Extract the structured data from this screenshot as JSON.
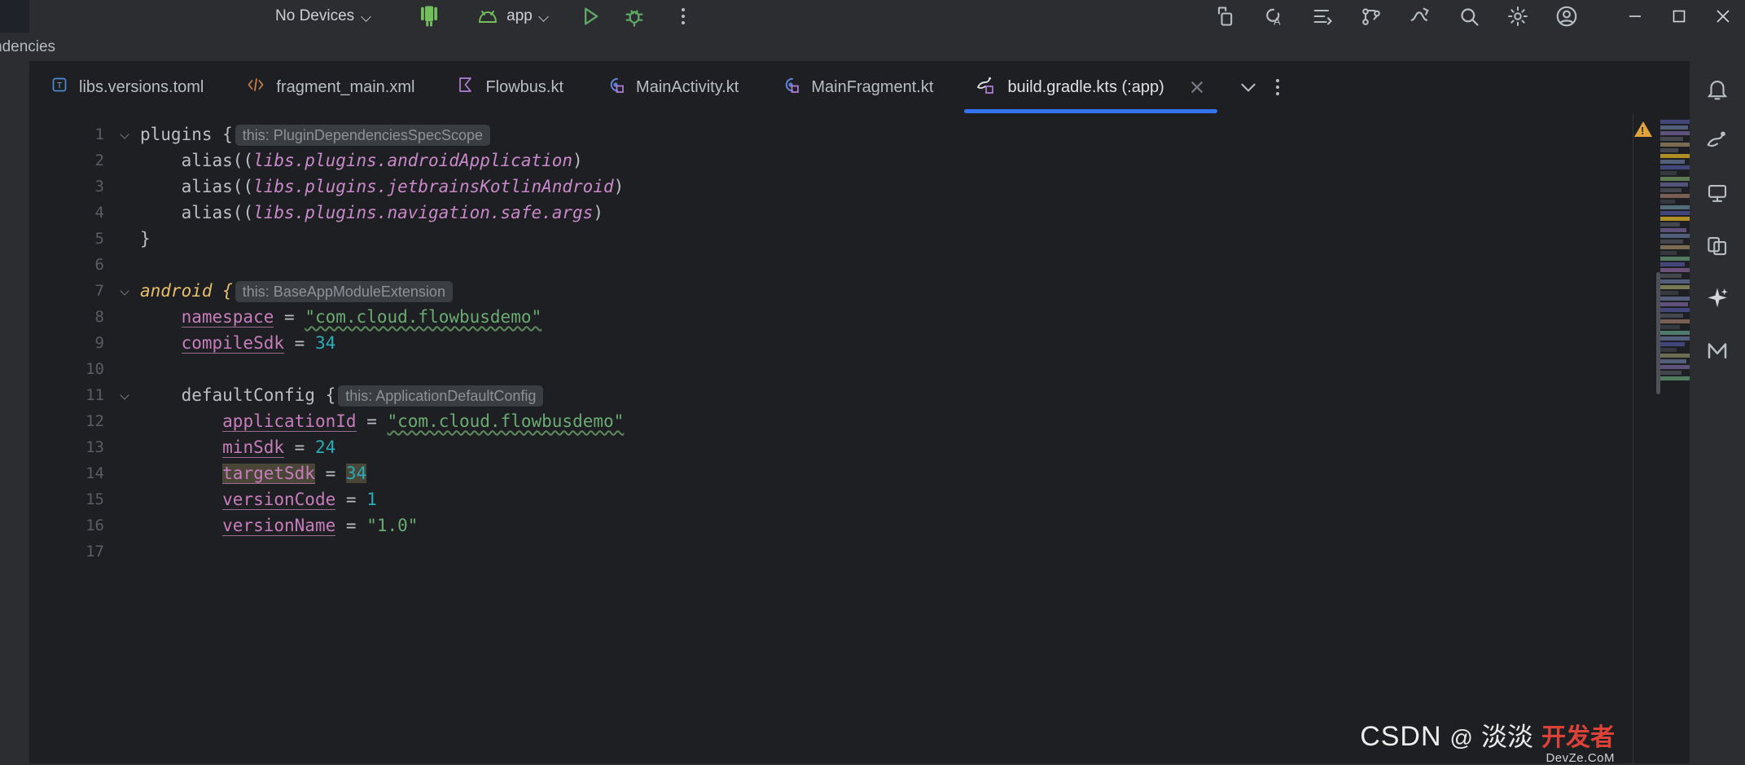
{
  "toolbar": {
    "device_selector": {
      "label": "No Devices",
      "icon": "chevron-down-icon"
    },
    "android_robot_icon": "android-robot-icon",
    "run_config": {
      "label": "app",
      "icon": "android-head-icon",
      "chevron": "chevron-down-icon"
    },
    "run_button": "run-icon",
    "debug_button": "debug-bug-icon",
    "more_button": "more-vertical-icon",
    "right_icons": [
      {
        "name": "device-manager-icon"
      },
      {
        "name": "code-with-me-icon"
      },
      {
        "name": "commit-icon"
      },
      {
        "name": "pull-requests-icon"
      },
      {
        "name": "updating-icon"
      },
      {
        "name": "search-everywhere-icon"
      },
      {
        "name": "settings-gear-icon"
      },
      {
        "name": "account-avatar-icon"
      }
    ],
    "window_controls": {
      "minimize": "minimize-icon",
      "maximize": "maximize-icon",
      "close": "close-icon"
    }
  },
  "breadcrumb": {
    "text": "ndencies"
  },
  "tabs": [
    {
      "label": "libs.versions.toml",
      "icon": "toml-file-icon",
      "icon_color": "#4e8ad4",
      "active": false
    },
    {
      "label": "fragment_main.xml",
      "icon": "xml-file-icon",
      "icon_color": "#c87d4b",
      "active": false
    },
    {
      "label": "Flowbus.kt",
      "icon": "kotlin-file-icon",
      "icon_color": "#b07fd4",
      "active": false
    },
    {
      "label": "MainActivity.kt",
      "icon": "kotlin-class-icon",
      "icon_color": "#5f7fd4",
      "active": false
    },
    {
      "label": "MainFragment.kt",
      "icon": "kotlin-class-icon",
      "icon_color": "#5f7fd4",
      "active": false
    },
    {
      "label": "build.gradle.kts (:app)",
      "icon": "gradle-file-icon",
      "icon_color": "#d6d9de",
      "active": true
    }
  ],
  "tab_controls": {
    "close_icon": "close-icon",
    "tab_list_icon": "chevron-down-icon",
    "tab_options_icon": "more-vertical-icon"
  },
  "editor": {
    "active_line_highlight": 14,
    "inlay_hints": {
      "plugins": "this: PluginDependenciesSpecScope",
      "android": "this: BaseAppModuleExtension",
      "defaultConfig": "this: ApplicationDefaultConfig"
    },
    "lines": [
      {
        "n": "1",
        "fold": true
      },
      {
        "n": "2",
        "fold": false
      },
      {
        "n": "3",
        "fold": false
      },
      {
        "n": "4",
        "fold": false
      },
      {
        "n": "5",
        "fold": false
      },
      {
        "n": "6",
        "fold": false
      },
      {
        "n": "7",
        "fold": true
      },
      {
        "n": "8",
        "fold": false
      },
      {
        "n": "9",
        "fold": false
      },
      {
        "n": "10",
        "fold": false
      },
      {
        "n": "11",
        "fold": true
      },
      {
        "n": "12",
        "fold": false
      },
      {
        "n": "13",
        "fold": false
      },
      {
        "n": "14",
        "fold": false
      },
      {
        "n": "15",
        "fold": false
      },
      {
        "n": "16",
        "fold": false
      },
      {
        "n": "17",
        "fold": false
      }
    ],
    "code": {
      "l1_plugins": "plugins {",
      "l2_alias": "    alias(",
      "l2_ref": "libs.plugins.androidApplication",
      "l3_ref": "libs.plugins.jetbrainsKotlinAndroid",
      "l4_ref": "libs.plugins.navigation.safe.args",
      "l5_close": "}",
      "l7_android": "android {",
      "l8_prop": "namespace",
      "l8_val": "\"com.cloud.flowbusdemo\"",
      "l9_prop": "compileSdk",
      "l9_val": "34",
      "l11_block": "defaultConfig {",
      "l12_prop": "applicationId",
      "l12_val": "\"com.cloud.flowbusdemo\"",
      "l13_prop": "minSdk",
      "l13_val": "24",
      "l14_prop": "targetSdk",
      "l14_val": "34",
      "l15_prop": "versionCode",
      "l15_val": "1",
      "l16_prop": "versionName",
      "l16_val": "\"1.0\"",
      "eq": "=",
      "paren_open": "(",
      "paren_close": ")"
    },
    "warning_badge": "warning-triangle-icon"
  },
  "right_rail": [
    {
      "name": "notifications-bell-icon"
    },
    {
      "name": "device-manager-icon"
    },
    {
      "name": "gradle-elephant-icon"
    },
    {
      "name": "resource-manager-icon"
    },
    {
      "name": "gemini-sparkle-icon"
    },
    {
      "name": "makefile-m-icon"
    }
  ],
  "watermark": {
    "brand": "CSDN",
    "at": "@",
    "author": "淡淡",
    "red_text": "开发者",
    "sub": "DevZe.CoM"
  },
  "colors": {
    "accent_blue": "#3574f0",
    "editor_bg": "#1e1f22",
    "chrome_bg": "#2b2d30",
    "text": "#bcbec4",
    "green": "#6aab73",
    "purple": "#c77dbb",
    "cyan": "#2aacb8",
    "orange": "#e8bf6a"
  }
}
